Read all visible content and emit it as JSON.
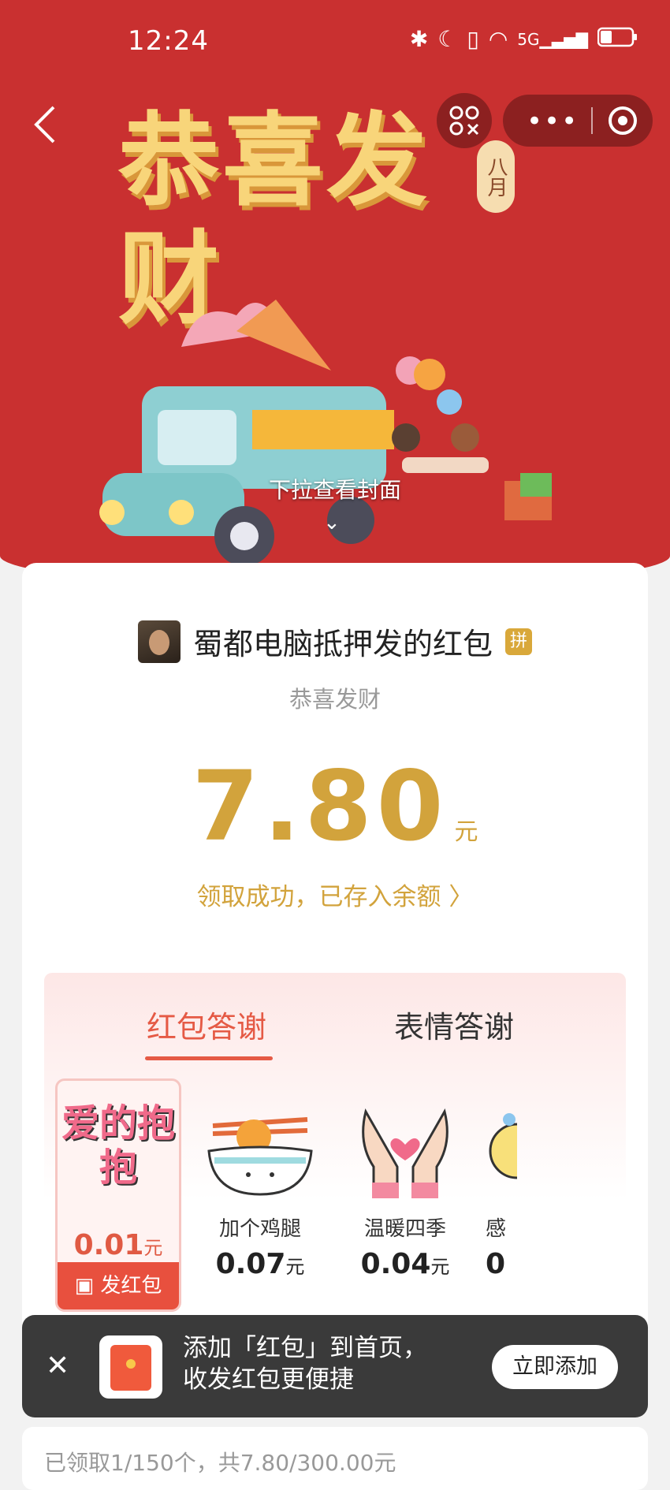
{
  "status_bar": {
    "time": "12:24",
    "icons": [
      "bluetooth-icon",
      "moon-icon",
      "vibrate-icon",
      "wifi-icon",
      "signal-5g-icon",
      "battery-icon"
    ]
  },
  "nav": {
    "back_icon": "chevron-left-icon",
    "menu_icon": "more-dots-icon",
    "close_icon": "target-icon",
    "share_icon": "share-icon"
  },
  "cover": {
    "title": "恭喜发财",
    "month_tag": "八月",
    "pull_hint": "下拉查看封面"
  },
  "packet": {
    "sender": "蜀都电脑抵押发的红包",
    "badge": "拼",
    "blessing": "恭喜发财",
    "amount": "7.80",
    "unit": "元",
    "received_link": "领取成功，已存入余额 〉"
  },
  "thanks": {
    "tabs": [
      "红包答谢",
      "表情答谢"
    ],
    "stickers": [
      {
        "art_text": "爱的抱抱",
        "price": "0.01",
        "unit": "元",
        "button": "发红包"
      },
      {
        "label": "加个鸡腿",
        "price": "0.07",
        "unit": "元"
      },
      {
        "label": "温暖四季",
        "price": "0.04",
        "unit": "元"
      },
      {
        "label": "感",
        "price": "0",
        "unit": ""
      }
    ]
  },
  "toast": {
    "text": "添加「红包」到首页，收发红包更便捷",
    "button": "立即添加"
  },
  "footer": {
    "summary": "已领取1/150个，共7.80/300.00元"
  },
  "colors": {
    "header_red": "#c93030",
    "gold": "#d2a33c",
    "accent_red": "#e55a45"
  }
}
